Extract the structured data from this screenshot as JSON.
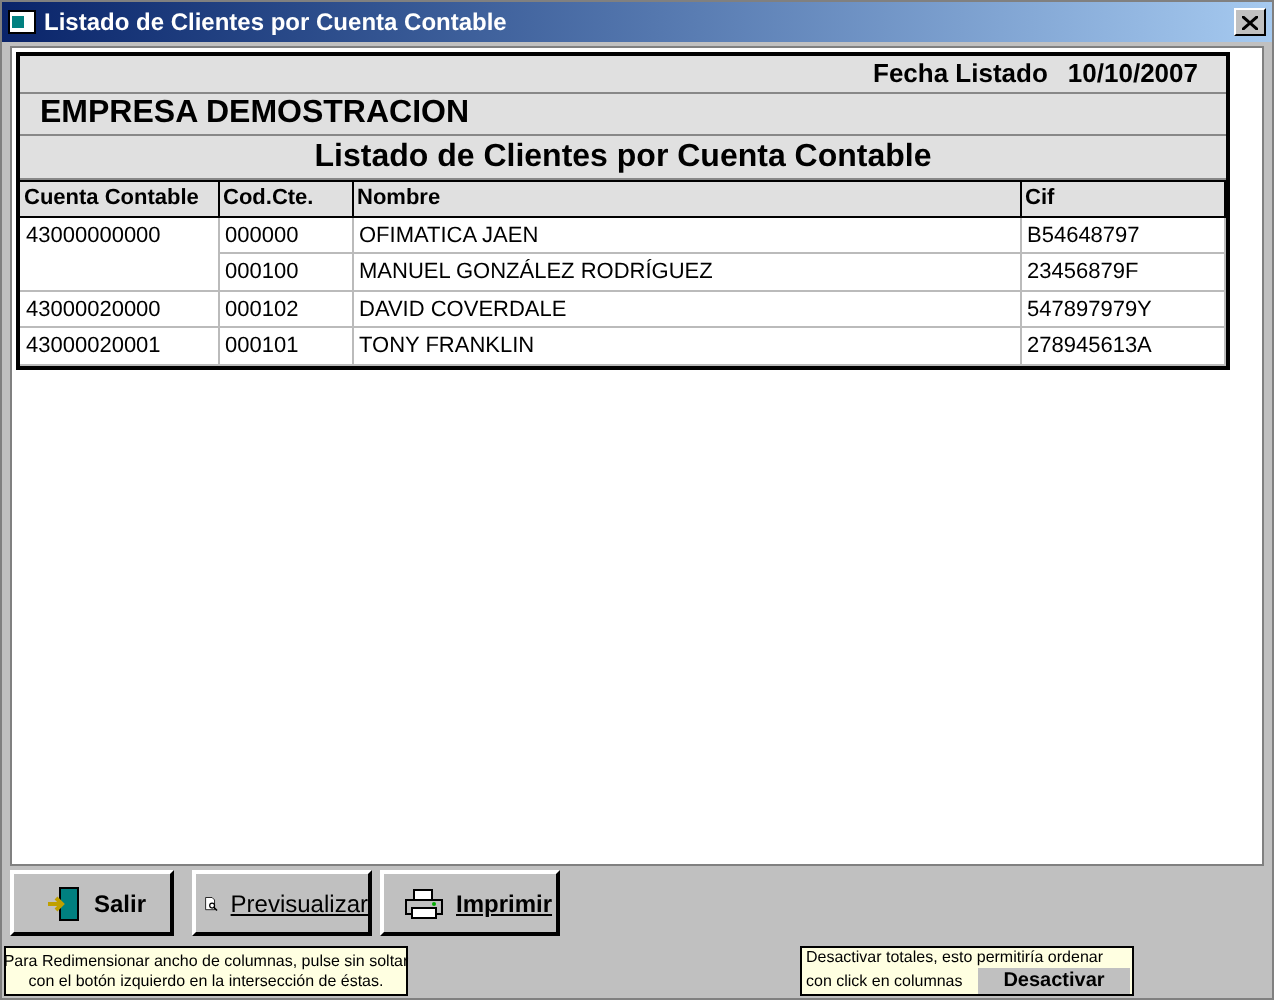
{
  "window": {
    "title": "Listado de Clientes por Cuenta Contable"
  },
  "report": {
    "date_label": "Fecha Listado",
    "date": "10/10/2007",
    "company": "EMPRESA DEMOSTRACION",
    "title": "Listado de Clientes por Cuenta Contable",
    "columns": [
      "Cuenta Contable",
      "Cod.Cte.",
      "Nombre",
      "Cif"
    ],
    "groups": [
      {
        "account": "43000000000",
        "rows": [
          {
            "code": "000000",
            "name": "OFIMATICA JAEN",
            "cif": "B54648797"
          },
          {
            "code": "000100",
            "name": "MANUEL GONZÁLEZ RODRÍGUEZ",
            "cif": "23456879F"
          }
        ]
      },
      {
        "account": "43000020000",
        "rows": [
          {
            "code": "000102",
            "name": "DAVID COVERDALE",
            "cif": "547897979Y"
          }
        ]
      },
      {
        "account": "43000020001",
        "rows": [
          {
            "code": "000101",
            "name": "TONY FRANKLIN",
            "cif": "278945613A"
          }
        ]
      }
    ]
  },
  "buttons": [
    {
      "kind": "exit",
      "label": "Salir"
    },
    {
      "kind": "preview",
      "label": "Previsualizar"
    },
    {
      "kind": "print",
      "label": "Imprimir"
    }
  ],
  "hints": {
    "resize": [
      "Para Redimensionar ancho de columnas, pulse sin soltar",
      "con el botón izquierdo en la intersección de éstas."
    ],
    "totals": [
      "Desactivar totales, esto permitiría ordenar",
      "con click en columnas"
    ],
    "totals_button": "Desactivar"
  }
}
